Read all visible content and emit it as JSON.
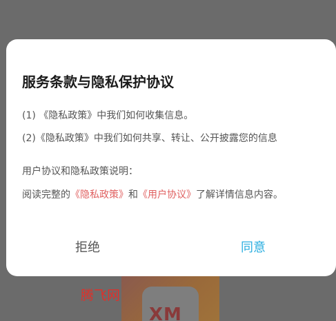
{
  "background": {
    "watermark": "腾飞网",
    "logo_text": "XM"
  },
  "dialog": {
    "title": "服务条款与隐私保护协议",
    "items": [
      "(1) 《隐私政策》中我们如何收集信息。",
      "(2)《隐私政策》中我们如何共享、转让、公开披露您的信息"
    ],
    "explain_heading": "用户协议和隐私政策说明：",
    "explain": {
      "prefix": "阅读完整的",
      "privacy_link": "《隐私政策》",
      "and": "和",
      "terms_link": "《用户协议》",
      "suffix": "了解详情信息内容。"
    },
    "reject_label": "拒绝",
    "agree_label": "同意"
  },
  "colors": {
    "link": "#e06060",
    "agree": "#2aaee0",
    "overlay": "#6b6b6b"
  }
}
